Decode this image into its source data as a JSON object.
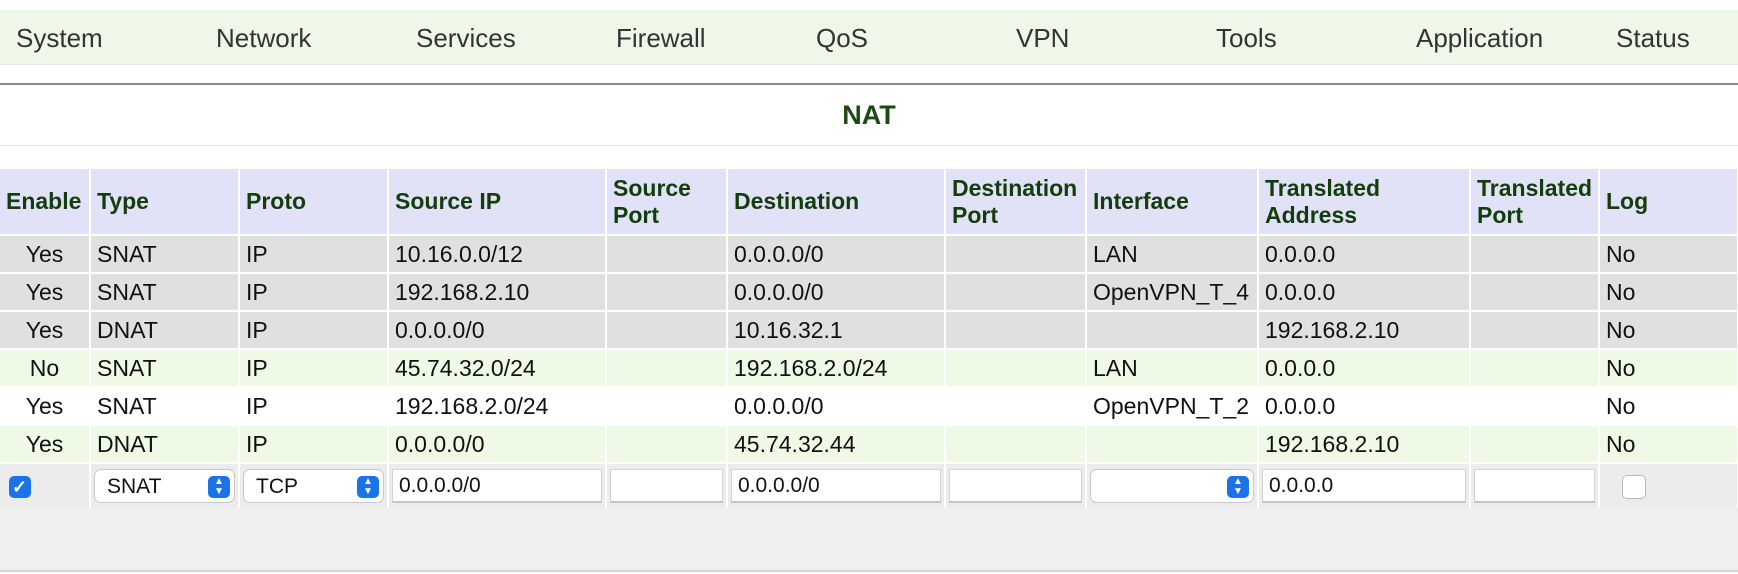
{
  "menu": [
    "System",
    "Network",
    "Services",
    "Firewall",
    "QoS",
    "VPN",
    "Tools",
    "Application",
    "Status"
  ],
  "page_title": "NAT",
  "table": {
    "headers": [
      "Enable",
      "Type",
      "Proto",
      "Source IP",
      "Source Port",
      "Destination",
      "Destination Port",
      "Interface",
      "Translated Address",
      "Translated Port",
      "Log"
    ],
    "rows": [
      [
        "Yes",
        "SNAT",
        "IP",
        "10.16.0.0/12",
        "",
        "0.0.0.0/0",
        "",
        "LAN",
        "0.0.0.0",
        "",
        "No"
      ],
      [
        "Yes",
        "SNAT",
        "IP",
        "192.168.2.10",
        "",
        "0.0.0.0/0",
        "",
        "OpenVPN_T_4",
        "0.0.0.0",
        "",
        "No"
      ],
      [
        "Yes",
        "DNAT",
        "IP",
        "0.0.0.0/0",
        "",
        "10.16.32.1",
        "",
        "",
        "192.168.2.10",
        "",
        "No"
      ],
      [
        "No",
        "SNAT",
        "IP",
        "45.74.32.0/24",
        "",
        "192.168.2.0/24",
        "",
        "LAN",
        "0.0.0.0",
        "",
        "No"
      ],
      [
        "Yes",
        "SNAT",
        "IP",
        "192.168.2.0/24",
        "",
        "0.0.0.0/0",
        "",
        "OpenVPN_T_2",
        "0.0.0.0",
        "",
        "No"
      ],
      [
        "Yes",
        "DNAT",
        "IP",
        "0.0.0.0/0",
        "",
        "45.74.32.44",
        "",
        "",
        "192.168.2.10",
        "",
        "No"
      ]
    ]
  },
  "edit_row": {
    "enable_checked": true,
    "type": "SNAT",
    "proto": "TCP",
    "source_ip": "0.0.0.0/0",
    "source_port": "",
    "destination": "0.0.0.0/0",
    "destination_port": "",
    "interface": "",
    "translated_address": "0.0.0.0",
    "translated_port": "",
    "log_checked": false
  },
  "colors": {
    "menu_bg": "#eef7e8",
    "header_bg": "#e1e1f7",
    "title_color": "#1c4a14",
    "accent": "#1a73e8"
  }
}
